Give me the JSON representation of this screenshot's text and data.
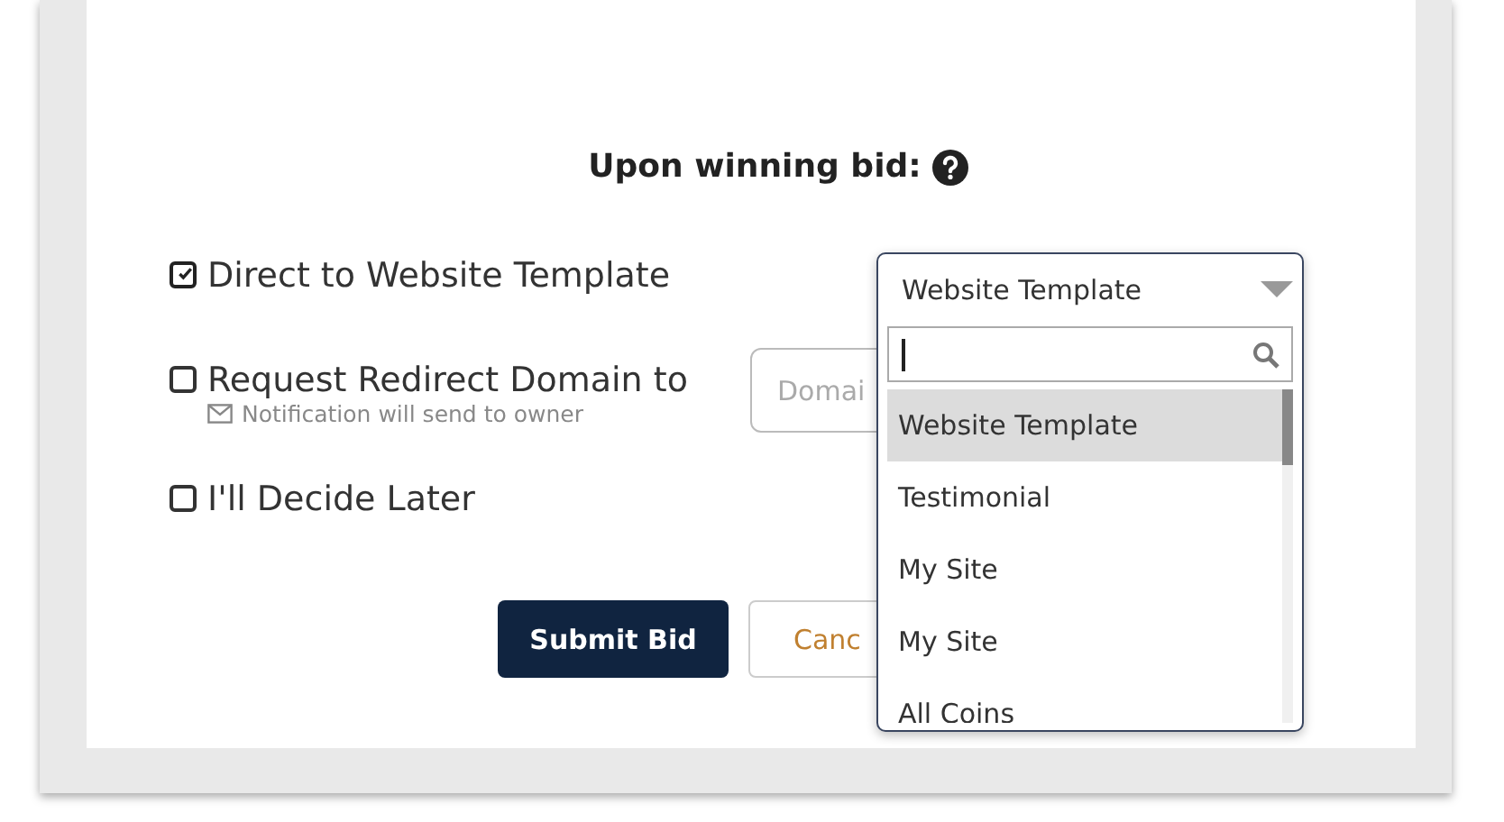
{
  "heading": "Upon winning bid:",
  "options": [
    {
      "label": "Direct to Website Template",
      "checked": true
    },
    {
      "label": "Request Redirect Domain to",
      "checked": false,
      "note": "Notification will send to owner",
      "field_placeholder": "Domai"
    },
    {
      "label": "I'll Decide Later",
      "checked": false
    }
  ],
  "buttons": [
    {
      "label": "Submit Bid",
      "kind": "primary"
    },
    {
      "label": "Canc",
      "kind": "secondary"
    }
  ],
  "dropdown": {
    "value": "Website Template",
    "items": [
      {
        "label": "Website Template",
        "selected": true
      },
      {
        "label": "Testimonial",
        "selected": false
      },
      {
        "label": "My Site",
        "selected": false
      },
      {
        "label": "My Site",
        "selected": false
      },
      {
        "label": "All Coins",
        "selected": false
      }
    ]
  }
}
